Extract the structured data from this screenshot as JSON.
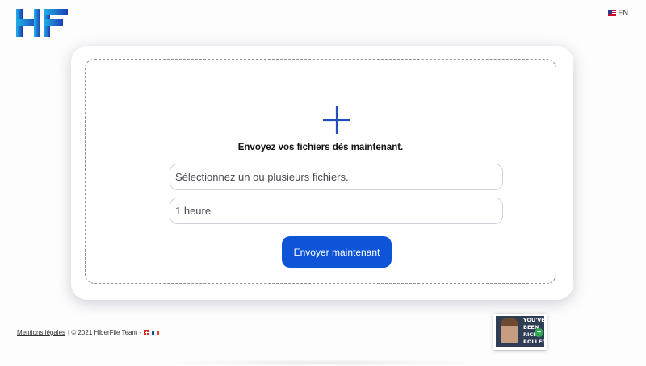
{
  "header": {
    "logo_text": "HF",
    "language_label": "EN"
  },
  "upload": {
    "prompt": "Envoyez vos fichiers dès maintenant.",
    "files_field": "Sélectionnez un ou plusieurs fichiers.",
    "duration_field": "1 heure",
    "send_button": "Envoyer maintenant"
  },
  "footer": {
    "legal_link": "Mentions légales",
    "copyright": "| © 2021 HiberFile Team -"
  },
  "thumbnail": {
    "lines": [
      "YOU'VE",
      "BEEN",
      "RICK",
      "ROLLED"
    ]
  },
  "colors": {
    "accent": "#0d54d9",
    "logo_gradient_start": "#1fa7e0",
    "logo_gradient_end": "#1a3fb8"
  }
}
